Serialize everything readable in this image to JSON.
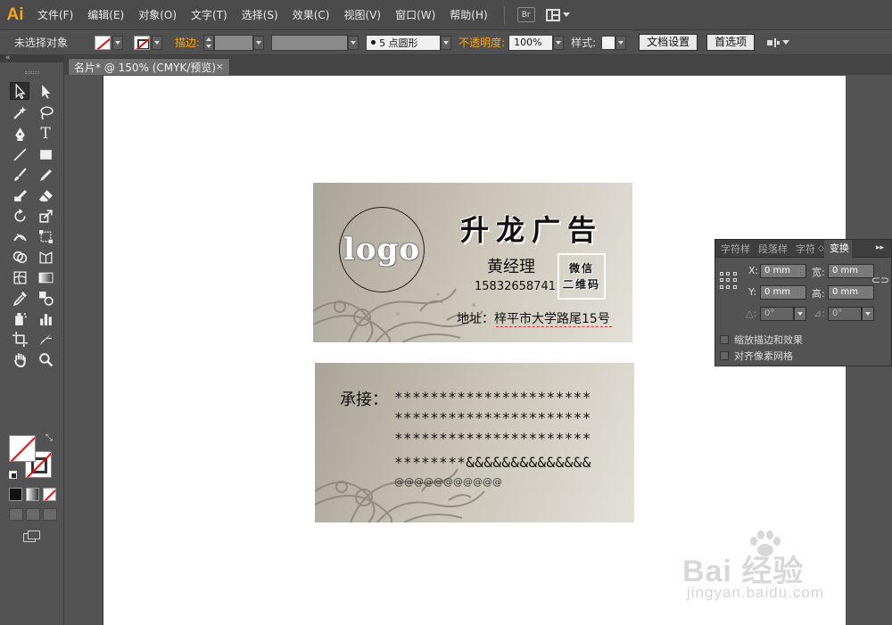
{
  "app": {
    "logo": "Ai"
  },
  "menu": [
    "文件(F)",
    "编辑(E)",
    "对象(O)",
    "文字(T)",
    "选择(S)",
    "效果(C)",
    "视图(V)",
    "窗口(W)",
    "帮助(H)"
  ],
  "menu_extras": {
    "bridge": "Br"
  },
  "control": {
    "selection_status": "未选择对象",
    "stroke_label": "描边:",
    "brush": "5 点圆形",
    "opacity_label": "不透明度:",
    "opacity": "100%",
    "style_label": "样式:",
    "doc_setup": "文档设置",
    "preferences": "首选项"
  },
  "document_tab": {
    "title": "名片* @ 150% (CMYK/预览)",
    "close": "×"
  },
  "card_front": {
    "logo": "logo",
    "company": "升龙广告",
    "manager": "黄经理",
    "phone": "15832658741",
    "qr_line1": "微信",
    "qr_line2": "二维码",
    "address": "地址：梓平市大学路尾15号"
  },
  "card_back": {
    "label": "承接：",
    "lines": [
      "**********************",
      "**********************",
      "**********************",
      "********&&&&&&&&&&&&&&"
    ],
    "at_line": "@@@@@@@@@@@"
  },
  "transform_panel": {
    "tabs": [
      "字符样",
      "段落样",
      "字符",
      "变换"
    ],
    "x_label": "X:",
    "x_value": "0 mm",
    "w_label": "宽:",
    "w_value": "0 mm",
    "y_label": "Y:",
    "y_value": "0 mm",
    "h_label": "高:",
    "h_value": "0 mm",
    "rotate_value": "0°",
    "shear_value": "0°",
    "scale_strokes": "缩放描边和效果",
    "align_pixel": "对齐像素网格"
  },
  "watermark": {
    "brand": "Bai 经验",
    "url": "jingyan.baidu.com"
  }
}
